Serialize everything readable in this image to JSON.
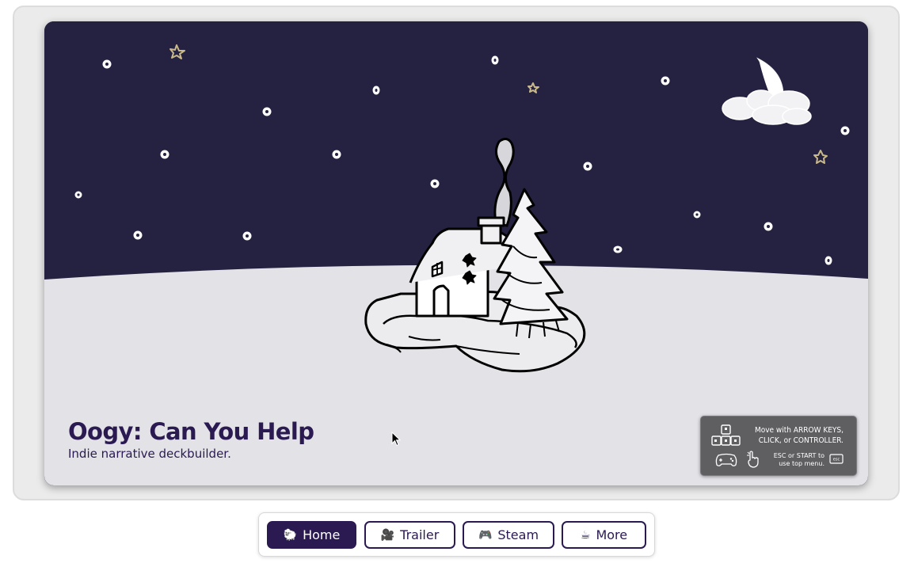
{
  "game": {
    "title": "Oogy: Can You Help",
    "subtitle": "Indie narrative deckbuilder."
  },
  "controls_hint": {
    "line1": "Move with ARROW KEYS, CLICK, or CONTROLLER.",
    "line2": "ESC or START to use top menu.",
    "esc_key": "esc"
  },
  "nav": {
    "items": [
      {
        "icon": "🐑",
        "label": "Home",
        "active": true
      },
      {
        "icon": "🎥",
        "label": "Trailer",
        "active": false
      },
      {
        "icon": "🎮",
        "label": "Steam",
        "active": false
      },
      {
        "icon": "☕",
        "label": "More",
        "active": false
      }
    ]
  },
  "colors": {
    "sky": "#252140",
    "snow": "#e2e2e7",
    "accent": "#2b1a52",
    "panel": "#5f5f62",
    "star": "#c9b98a"
  }
}
